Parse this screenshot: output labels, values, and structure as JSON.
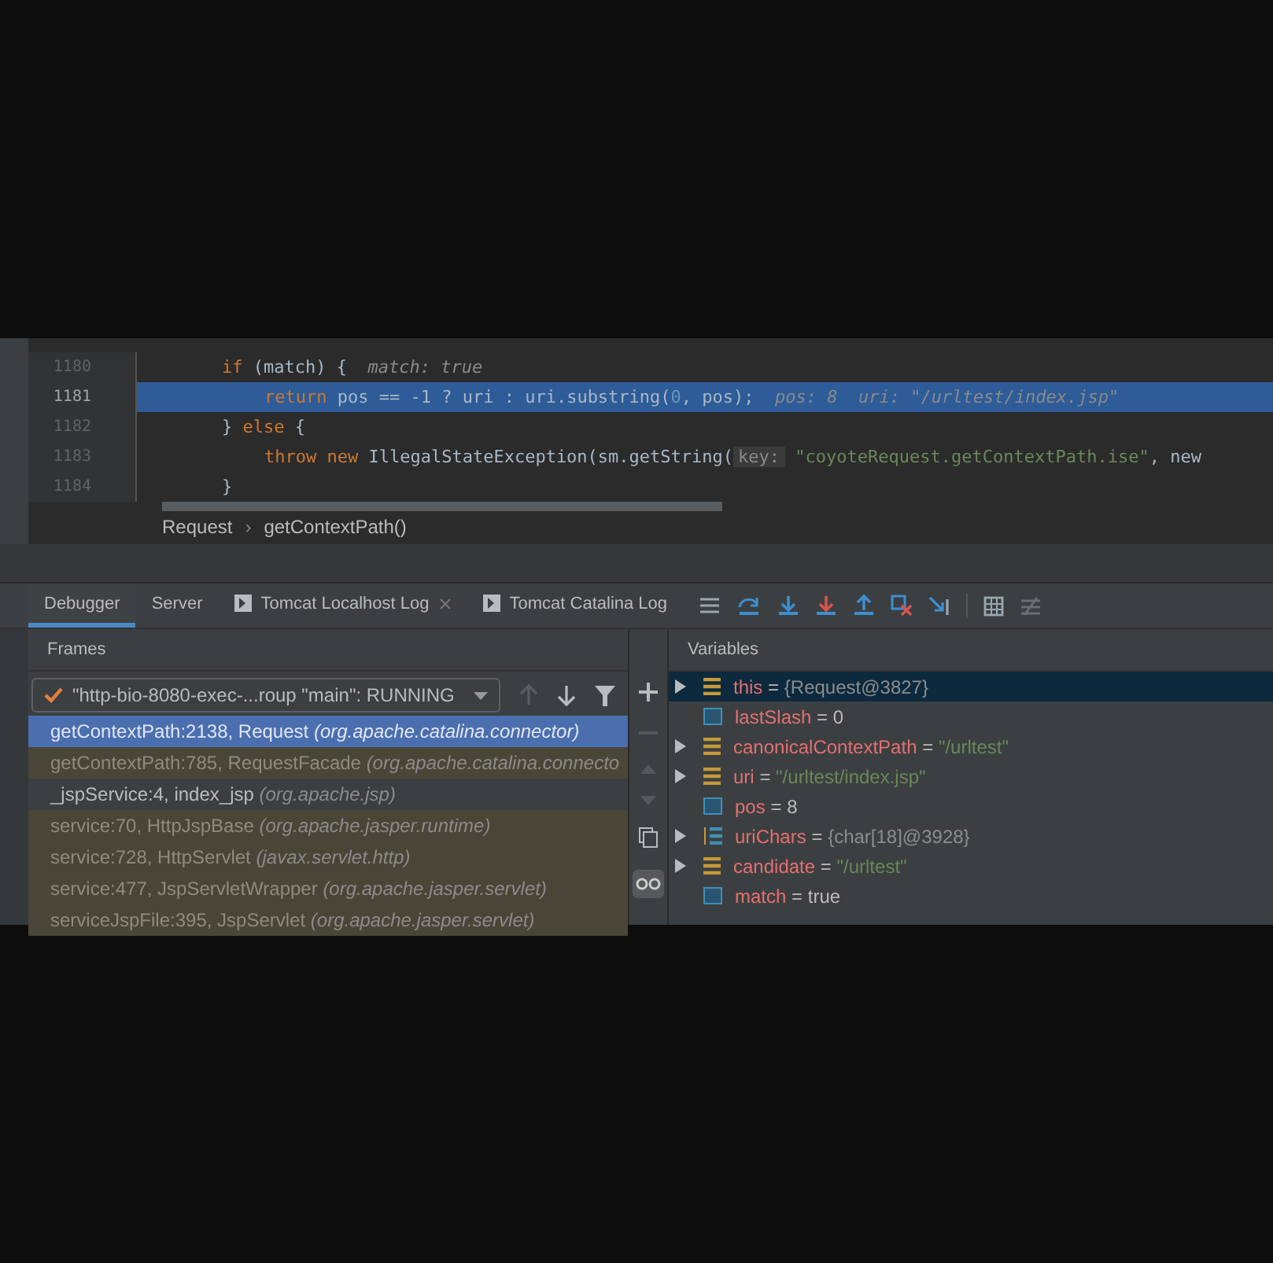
{
  "editor": {
    "lines": [
      {
        "number": "1180",
        "selected": false,
        "segments": [
          {
            "kind": "keyword",
            "text": "if"
          },
          {
            "kind": "plain",
            "text": " (match) {"
          },
          {
            "kind": "hint",
            "text": "  match: true"
          }
        ],
        "children": [
          {
            "number": "1181",
            "selected": true,
            "segments": [
              {
                "kind": "keyword",
                "text": "return"
              },
              {
                "kind": "plain",
                "text": " pos == -1 ? uri : uri.substring("
              },
              {
                "kind": "number",
                "text": "0"
              },
              {
                "kind": "plain",
                "text": ", pos);"
              },
              {
                "kind": "hint",
                "text": "  pos: 8  uri: \"/urltest/index.jsp\""
              }
            ]
          }
        ]
      },
      {
        "number": "1182",
        "selected": false,
        "segments": [
          {
            "kind": "plain",
            "text": "} "
          },
          {
            "kind": "keyword",
            "text": "else"
          },
          {
            "kind": "plain",
            "text": " {"
          }
        ],
        "children": [
          {
            "number": "1183",
            "selected": false,
            "segments": [
              {
                "kind": "keyword",
                "text": "throw new"
              },
              {
                "kind": "plain",
                "text": " IllegalStateException(sm.getString("
              },
              {
                "kind": "param",
                "text": "key:"
              },
              {
                "kind": "string",
                "text": " \"coyoteRequest.getContextPath.ise\""
              },
              {
                "kind": "plain",
                "text": ", new"
              }
            ]
          }
        ]
      },
      {
        "number": "1184",
        "selected": false,
        "segments": [
          {
            "kind": "plain",
            "text": "}"
          }
        ]
      }
    ],
    "breadcrumb": {
      "items": [
        "Request",
        "getContextPath()"
      ],
      "separator": "›"
    }
  },
  "tabs": [
    {
      "label": "Debugger",
      "selected": true,
      "console_icon": false,
      "closable": false
    },
    {
      "label": "Server",
      "selected": false,
      "console_icon": false,
      "closable": false
    },
    {
      "label": "Tomcat Localhost Log",
      "selected": false,
      "console_icon": true,
      "closable": true
    },
    {
      "label": "Tomcat Catalina Log",
      "selected": false,
      "console_icon": true,
      "closable": false
    }
  ],
  "frames": {
    "title": "Frames",
    "thread": "\"http-bio-8080-exec-...roup \"main\": RUNNING",
    "items": [
      {
        "method": "getContextPath:2138, Request",
        "package": "(org.apache.catalina.connector)",
        "selected": true,
        "kind": "library"
      },
      {
        "method": "getContextPath:785, RequestFacade",
        "package": "(org.apache.catalina.connecto",
        "selected": false,
        "kind": "library"
      },
      {
        "method": "_jspService:4, index_jsp",
        "package": "(org.apache.jsp)",
        "selected": false,
        "kind": "user"
      },
      {
        "method": "service:70, HttpJspBase",
        "package": "(org.apache.jasper.runtime)",
        "selected": false,
        "kind": "library"
      },
      {
        "method": "service:728, HttpServlet",
        "package": "(javax.servlet.http)",
        "selected": false,
        "kind": "library"
      },
      {
        "method": "service:477, JspServletWrapper",
        "package": "(org.apache.jasper.servlet)",
        "selected": false,
        "kind": "library"
      },
      {
        "method": "serviceJspFile:395, JspServlet",
        "package": "(org.apache.jasper.servlet)",
        "selected": false,
        "kind": "library"
      }
    ]
  },
  "variables": {
    "title": "Variables",
    "items": [
      {
        "kind": "object",
        "name": "this",
        "sep": "=",
        "value": "{Request@3827}",
        "expandable": true,
        "selected": true
      },
      {
        "kind": "primitive",
        "name": "lastSlash",
        "sep": "=",
        "value": "0",
        "expandable": false,
        "selected": false
      },
      {
        "kind": "string",
        "name": "canonicalContextPath",
        "sep": "=",
        "value": "\"/urltest\"",
        "expandable": true,
        "selected": false
      },
      {
        "kind": "string",
        "name": "uri",
        "sep": "=",
        "value": "\"/urltest/index.jsp\"",
        "expandable": true,
        "selected": false
      },
      {
        "kind": "primitive",
        "name": "pos",
        "sep": "=",
        "value": "8",
        "expandable": false,
        "selected": false
      },
      {
        "kind": "array",
        "name": "uriChars",
        "sep": "=",
        "value": "{char[18]@3928}",
        "expandable": true,
        "selected": false
      },
      {
        "kind": "string",
        "name": "candidate",
        "sep": "=",
        "value": "\"/urltest\"",
        "expandable": true,
        "selected": false
      },
      {
        "kind": "primitive",
        "name": "match",
        "sep": "=",
        "value": "true",
        "expandable": false,
        "selected": false
      }
    ]
  }
}
